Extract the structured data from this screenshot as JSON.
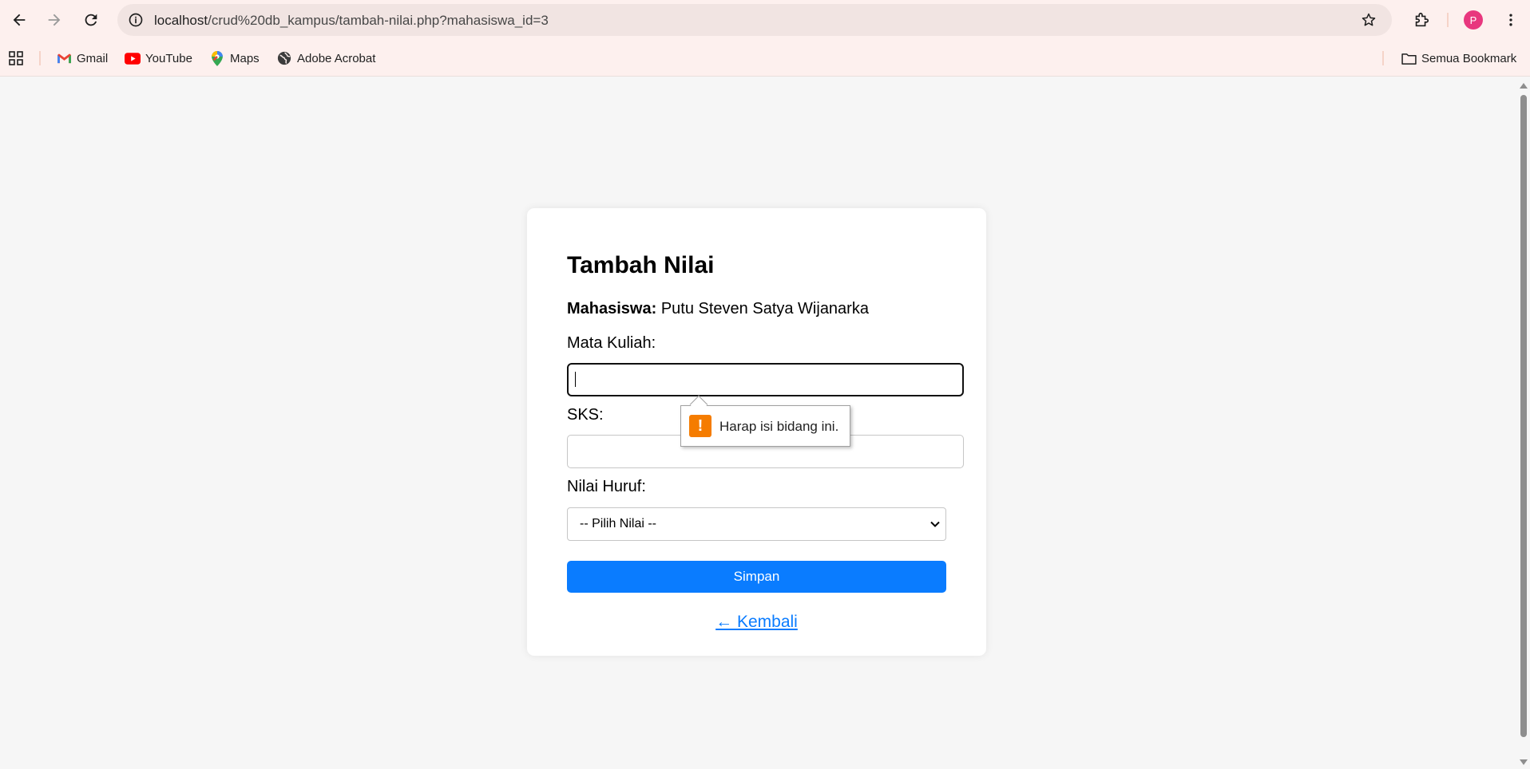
{
  "browser": {
    "url_host": "localhost",
    "url_path": "/crud%20db_kampus/tambah-nilai.php?mahasiswa_id=3",
    "avatar_letter": "P",
    "icons": [
      "back-icon",
      "forward-icon",
      "reload-icon",
      "site-info-icon",
      "star-icon",
      "extensions-icon",
      "more-menu-icon"
    ]
  },
  "bookmarks": {
    "items": [
      {
        "label": "Gmail",
        "icon": "gmail-icon"
      },
      {
        "label": "YouTube",
        "icon": "youtube-icon"
      },
      {
        "label": "Maps",
        "icon": "maps-icon"
      },
      {
        "label": "Adobe Acrobat",
        "icon": "globe-icon"
      }
    ],
    "all_bookmarks_label": "Semua Bookmark"
  },
  "form": {
    "title": "Tambah Nilai",
    "student_label": "Mahasiswa:",
    "student_name": "Putu Steven Satya Wijanarka",
    "course_label": "Mata Kuliah:",
    "course_value": "",
    "sks_label": "SKS:",
    "sks_value": "",
    "grade_label": "Nilai Huruf:",
    "grade_selected": "-- Pilih Nilai --",
    "submit_label": "Simpan",
    "back_link": "← Kembali"
  },
  "validation": {
    "message": "Harap isi bidang ini."
  },
  "colors": {
    "primary": "#0a7cff",
    "warning": "#f57c00",
    "page_bg": "#f6f6f6",
    "chrome_bg": "#fdf0ee"
  }
}
